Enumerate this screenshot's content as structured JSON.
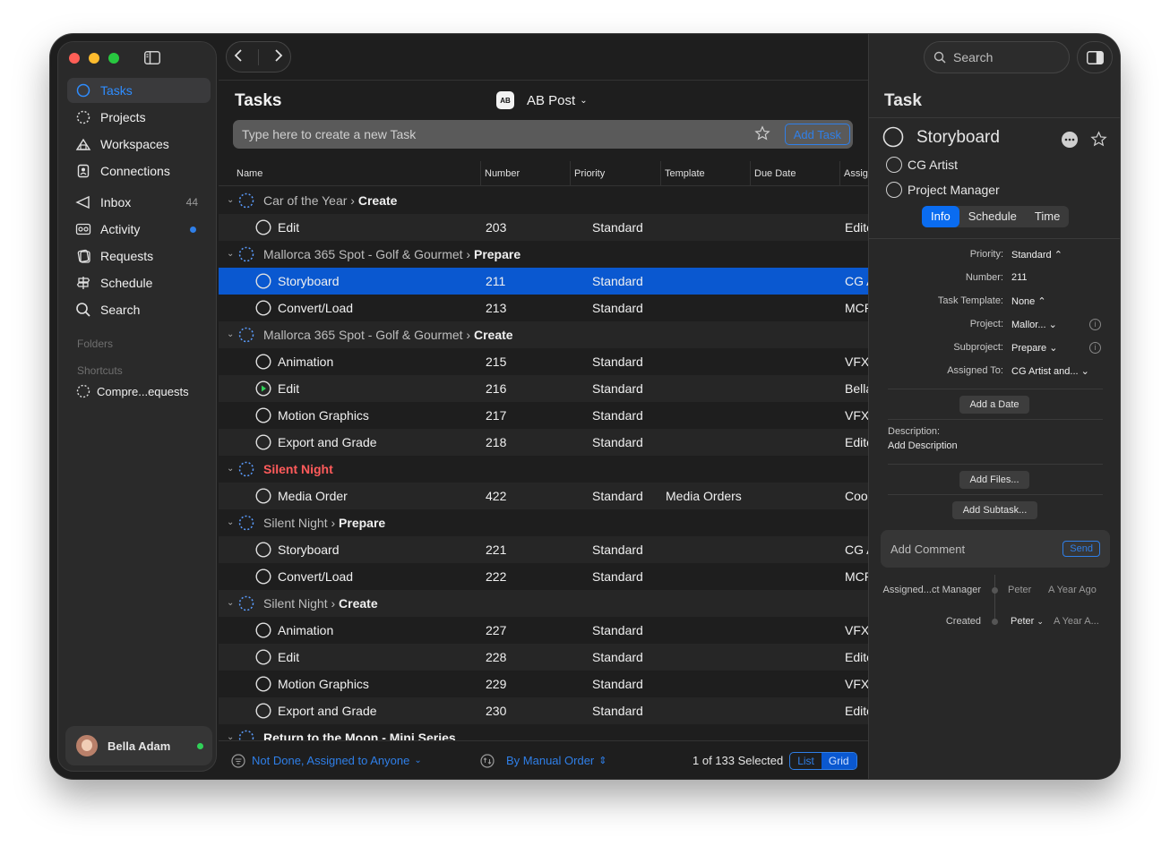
{
  "sidebar": {
    "items": [
      {
        "label": "Tasks",
        "icon": "circle-icon"
      },
      {
        "label": "Projects",
        "icon": "dotted-circle-icon"
      },
      {
        "label": "Workspaces",
        "icon": "workspaces-icon"
      },
      {
        "label": "Connections",
        "icon": "contact-book-icon"
      },
      {
        "label": "Inbox",
        "icon": "inbox-icon",
        "count": "44"
      },
      {
        "label": "Activity",
        "icon": "activity-icon"
      },
      {
        "label": "Requests",
        "icon": "requests-icon"
      },
      {
        "label": "Schedule",
        "icon": "signpost-icon"
      },
      {
        "label": "Search",
        "icon": "search-icon"
      }
    ],
    "folders_label": "Folders",
    "shortcuts_label": "Shortcuts",
    "shortcut_item": "Compre...equests",
    "user_name": "Bella Adam"
  },
  "main": {
    "title": "Tasks",
    "workspace": "AB Post",
    "workspace_logo": "AB",
    "new_task_placeholder": "Type here to create a new Task",
    "add_task_label": "Add Task",
    "columns": [
      "Name",
      "Number",
      "Priority",
      "Template",
      "Due Date",
      "Assig"
    ],
    "rows": [
      {
        "type": "project",
        "prefix": "Car of the Year › ",
        "phase": "Create"
      },
      {
        "type": "task",
        "name": "Edit",
        "number": "203",
        "priority": "Standard",
        "template": "",
        "assign": "Edito"
      },
      {
        "type": "project",
        "prefix": "Mallorca 365 Spot - Golf & Gourmet › ",
        "phase": "Prepare"
      },
      {
        "type": "task",
        "name": "Storyboard",
        "number": "211",
        "priority": "Standard",
        "template": "",
        "assign": "CG A",
        "selected": true
      },
      {
        "type": "task",
        "name": "Convert/Load",
        "number": "213",
        "priority": "Standard",
        "template": "",
        "assign": "MCR"
      },
      {
        "type": "project",
        "prefix": "Mallorca 365 Spot - Golf & Gourmet › ",
        "phase": "Create"
      },
      {
        "type": "task",
        "name": "Animation",
        "number": "215",
        "priority": "Standard",
        "template": "",
        "assign": "VFX"
      },
      {
        "type": "task",
        "name": "Edit",
        "number": "216",
        "priority": "Standard",
        "template": "",
        "assign": "Bella",
        "status": "in-progress"
      },
      {
        "type": "task",
        "name": "Motion Graphics",
        "number": "217",
        "priority": "Standard",
        "template": "",
        "assign": "VFX"
      },
      {
        "type": "task",
        "name": "Export and Grade",
        "number": "218",
        "priority": "Standard",
        "template": "",
        "assign": "Edito"
      },
      {
        "type": "project",
        "prefix": "",
        "phase": "Silent Night",
        "style": "red"
      },
      {
        "type": "task",
        "name": "Media Order",
        "number": "422",
        "priority": "Standard",
        "template": "Media Orders",
        "assign": "Coor"
      },
      {
        "type": "project",
        "prefix": "Silent Night › ",
        "phase": "Prepare"
      },
      {
        "type": "task",
        "name": "Storyboard",
        "number": "221",
        "priority": "Standard",
        "template": "",
        "assign": "CG A"
      },
      {
        "type": "task",
        "name": "Convert/Load",
        "number": "222",
        "priority": "Standard",
        "template": "",
        "assign": "MCR"
      },
      {
        "type": "project",
        "prefix": "Silent Night › ",
        "phase": "Create"
      },
      {
        "type": "task",
        "name": "Animation",
        "number": "227",
        "priority": "Standard",
        "template": "",
        "assign": "VFX"
      },
      {
        "type": "task",
        "name": "Edit",
        "number": "228",
        "priority": "Standard",
        "template": "",
        "assign": "Edito"
      },
      {
        "type": "task",
        "name": "Motion Graphics",
        "number": "229",
        "priority": "Standard",
        "template": "",
        "assign": "VFX"
      },
      {
        "type": "task",
        "name": "Export and Grade",
        "number": "230",
        "priority": "Standard",
        "template": "",
        "assign": "Edito"
      },
      {
        "type": "project",
        "prefix": "",
        "phase": "Return to the Moon - Mini Series",
        "style": "white"
      }
    ],
    "filter_label": "Not Done, Assigned to Anyone",
    "sort_label": "By Manual Order",
    "selection_count": "1 of 133 Selected",
    "view_list": "List",
    "view_grid": "Grid"
  },
  "inspector": {
    "search_placeholder": "Search",
    "title": "Task",
    "task_name": "Storyboard",
    "assignees": [
      "CG Artist",
      "Project Manager"
    ],
    "tabs": [
      "Info",
      "Schedule",
      "Time"
    ],
    "fields": [
      {
        "label": "Priority:",
        "value": "Standard ⌃",
        "info": false
      },
      {
        "label": "Number:",
        "value": "211",
        "info": false
      },
      {
        "label": "Task Template:",
        "value": "None ⌃",
        "info": false
      },
      {
        "label": "Project:",
        "value": "Mallor...  ⌄",
        "info": true
      },
      {
        "label": "Subproject:",
        "value": "Prepare  ⌄",
        "info": true
      },
      {
        "label": "Assigned To:",
        "value": "CG Artist and...  ⌄",
        "info": false
      }
    ],
    "add_date_label": "Add a Date",
    "description_label": "Description:",
    "description_value": "Add Description",
    "add_files_label": "Add Files...",
    "add_subtask_label": "Add Subtask...",
    "comment_placeholder": "Add Comment",
    "send_label": "Send",
    "activity": [
      {
        "event": "Assigned...ct Manager",
        "who": "Peter",
        "when": "A Year Ago"
      },
      {
        "event": "Created",
        "who": "Peter",
        "when": "A Year A..."
      }
    ]
  },
  "colors": {
    "accent": "#2f7fe8",
    "selection": "#0a58d0",
    "red_project": "#ff5b5b"
  }
}
